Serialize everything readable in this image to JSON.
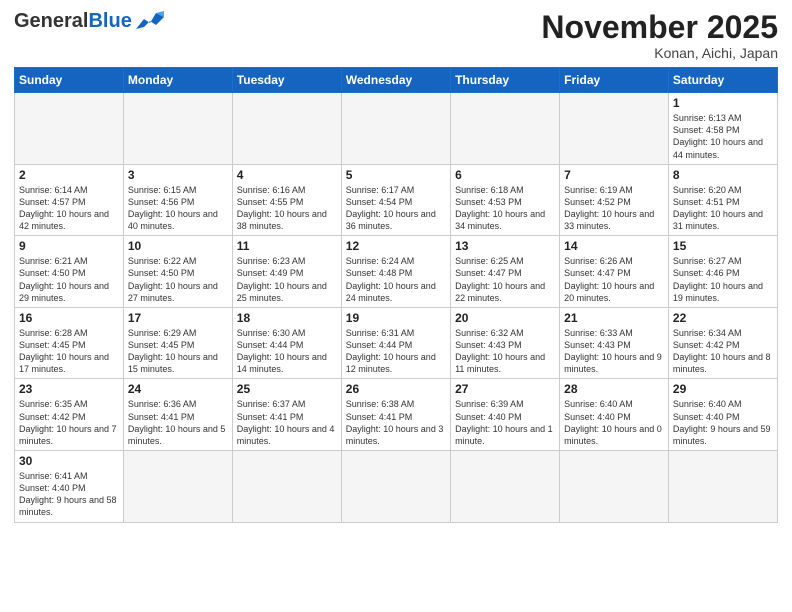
{
  "logo": {
    "general": "General",
    "blue": "Blue"
  },
  "title": "November 2025",
  "location": "Konan, Aichi, Japan",
  "weekdays": [
    "Sunday",
    "Monday",
    "Tuesday",
    "Wednesday",
    "Thursday",
    "Friday",
    "Saturday"
  ],
  "days": {
    "1": {
      "sunrise": "6:13 AM",
      "sunset": "4:58 PM",
      "daylight": "10 hours and 44 minutes."
    },
    "2": {
      "sunrise": "6:14 AM",
      "sunset": "4:57 PM",
      "daylight": "10 hours and 42 minutes."
    },
    "3": {
      "sunrise": "6:15 AM",
      "sunset": "4:56 PM",
      "daylight": "10 hours and 40 minutes."
    },
    "4": {
      "sunrise": "6:16 AM",
      "sunset": "4:55 PM",
      "daylight": "10 hours and 38 minutes."
    },
    "5": {
      "sunrise": "6:17 AM",
      "sunset": "4:54 PM",
      "daylight": "10 hours and 36 minutes."
    },
    "6": {
      "sunrise": "6:18 AM",
      "sunset": "4:53 PM",
      "daylight": "10 hours and 34 minutes."
    },
    "7": {
      "sunrise": "6:19 AM",
      "sunset": "4:52 PM",
      "daylight": "10 hours and 33 minutes."
    },
    "8": {
      "sunrise": "6:20 AM",
      "sunset": "4:51 PM",
      "daylight": "10 hours and 31 minutes."
    },
    "9": {
      "sunrise": "6:21 AM",
      "sunset": "4:50 PM",
      "daylight": "10 hours and 29 minutes."
    },
    "10": {
      "sunrise": "6:22 AM",
      "sunset": "4:50 PM",
      "daylight": "10 hours and 27 minutes."
    },
    "11": {
      "sunrise": "6:23 AM",
      "sunset": "4:49 PM",
      "daylight": "10 hours and 25 minutes."
    },
    "12": {
      "sunrise": "6:24 AM",
      "sunset": "4:48 PM",
      "daylight": "10 hours and 24 minutes."
    },
    "13": {
      "sunrise": "6:25 AM",
      "sunset": "4:47 PM",
      "daylight": "10 hours and 22 minutes."
    },
    "14": {
      "sunrise": "6:26 AM",
      "sunset": "4:47 PM",
      "daylight": "10 hours and 20 minutes."
    },
    "15": {
      "sunrise": "6:27 AM",
      "sunset": "4:46 PM",
      "daylight": "10 hours and 19 minutes."
    },
    "16": {
      "sunrise": "6:28 AM",
      "sunset": "4:45 PM",
      "daylight": "10 hours and 17 minutes."
    },
    "17": {
      "sunrise": "6:29 AM",
      "sunset": "4:45 PM",
      "daylight": "10 hours and 15 minutes."
    },
    "18": {
      "sunrise": "6:30 AM",
      "sunset": "4:44 PM",
      "daylight": "10 hours and 14 minutes."
    },
    "19": {
      "sunrise": "6:31 AM",
      "sunset": "4:44 PM",
      "daylight": "10 hours and 12 minutes."
    },
    "20": {
      "sunrise": "6:32 AM",
      "sunset": "4:43 PM",
      "daylight": "10 hours and 11 minutes."
    },
    "21": {
      "sunrise": "6:33 AM",
      "sunset": "4:43 PM",
      "daylight": "10 hours and 9 minutes."
    },
    "22": {
      "sunrise": "6:34 AM",
      "sunset": "4:42 PM",
      "daylight": "10 hours and 8 minutes."
    },
    "23": {
      "sunrise": "6:35 AM",
      "sunset": "4:42 PM",
      "daylight": "10 hours and 7 minutes."
    },
    "24": {
      "sunrise": "6:36 AM",
      "sunset": "4:41 PM",
      "daylight": "10 hours and 5 minutes."
    },
    "25": {
      "sunrise": "6:37 AM",
      "sunset": "4:41 PM",
      "daylight": "10 hours and 4 minutes."
    },
    "26": {
      "sunrise": "6:38 AM",
      "sunset": "4:41 PM",
      "daylight": "10 hours and 3 minutes."
    },
    "27": {
      "sunrise": "6:39 AM",
      "sunset": "4:40 PM",
      "daylight": "10 hours and 1 minute."
    },
    "28": {
      "sunrise": "6:40 AM",
      "sunset": "4:40 PM",
      "daylight": "10 hours and 0 minutes."
    },
    "29": {
      "sunrise": "6:40 AM",
      "sunset": "4:40 PM",
      "daylight": "9 hours and 59 minutes."
    },
    "30": {
      "sunrise": "6:41 AM",
      "sunset": "4:40 PM",
      "daylight": "9 hours and 58 minutes."
    }
  }
}
